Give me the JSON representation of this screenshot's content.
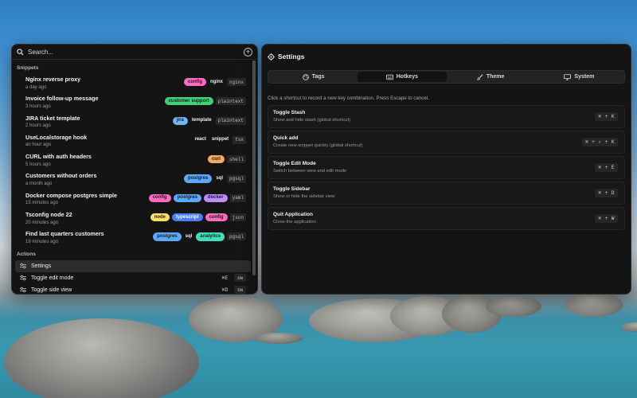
{
  "search": {
    "placeholder": "Search..."
  },
  "snippets": {
    "section_title": "Snippets",
    "items": [
      {
        "name": "Nginx reverse proxy",
        "time": "a day ago",
        "tags": [
          {
            "label": "config",
            "color": "#ff6bc1"
          },
          {
            "label": "nginx",
            "color": null
          }
        ],
        "lang": "nginx"
      },
      {
        "name": "Invoice follow-up message",
        "time": "3 hours ago",
        "tags": [
          {
            "label": "customer support",
            "color": "#3fd17a"
          }
        ],
        "lang": "plaintext"
      },
      {
        "name": "JIRA ticket template",
        "time": "2 hours ago",
        "tags": [
          {
            "label": "jira",
            "color": "#6fb6ff"
          },
          {
            "label": "template",
            "color": null
          }
        ],
        "lang": "plaintext"
      },
      {
        "name": "UseLocalstorage hook",
        "time": "an hour ago",
        "tags": [
          {
            "label": "react",
            "color": null
          },
          {
            "label": "snippet",
            "color": null
          }
        ],
        "lang": "tsx"
      },
      {
        "name": "CURL with auth headers",
        "time": "5 hours ago",
        "tags": [
          {
            "label": "curl",
            "color": "#ffaa66"
          }
        ],
        "lang": "shell"
      },
      {
        "name": "Customers without orders",
        "time": "a month ago",
        "tags": [
          {
            "label": "postgres",
            "color": "#5ba8ff"
          },
          {
            "label": "sql",
            "color": null
          }
        ],
        "lang": "pgsql"
      },
      {
        "name": "Docker compose postgres simple",
        "time": "15 minutes ago",
        "tags": [
          {
            "label": "config",
            "color": "#ff6bc1"
          },
          {
            "label": "postgres",
            "color": "#5ba8ff"
          },
          {
            "label": "docker",
            "color": "#c08cff"
          }
        ],
        "lang": "yaml"
      },
      {
        "name": "Tsconfig node 22",
        "time": "20 minutes ago",
        "tags": [
          {
            "label": "node",
            "color": "#ffe066"
          },
          {
            "label": "typescript",
            "color": "#4a7cff"
          },
          {
            "label": "config",
            "color": "#ff6bc1"
          }
        ],
        "lang": "json"
      },
      {
        "name": "Find last quarters customers",
        "time": "19 minutes ago",
        "tags": [
          {
            "label": "postgres",
            "color": "#5ba8ff"
          },
          {
            "label": "sql",
            "color": null
          },
          {
            "label": "analytics",
            "color": "#3fe0b8"
          }
        ],
        "lang": "pgsql"
      }
    ]
  },
  "actions": {
    "section_title": "Actions",
    "items": [
      {
        "label": "Settings",
        "shortcut": "",
        "state": "",
        "active": true
      },
      {
        "label": "Toggle edit mode",
        "shortcut": "⌘E",
        "state": "ON",
        "active": false
      },
      {
        "label": "Toggle side view",
        "shortcut": "⌘D",
        "state": "ON",
        "active": false
      }
    ]
  },
  "settings": {
    "title": "Settings",
    "tabs": [
      {
        "label": "Tags",
        "icon": "palette-icon",
        "active": false
      },
      {
        "label": "Hotkeys",
        "icon": "keyboard-icon",
        "active": true
      },
      {
        "label": "Theme",
        "icon": "brush-icon",
        "active": false
      },
      {
        "label": "System",
        "icon": "monitor-icon",
        "active": false
      }
    ],
    "instruction": "Click a shortcut to record a new key combination. Press Escape to cancel.",
    "hotkeys": [
      {
        "title": "Toggle Stash",
        "desc": "Show and hide stash (global shortcut)",
        "keys": "⌘ + K"
      },
      {
        "title": "Quick add",
        "desc": "Create new snippet quickly (global shortcut)",
        "keys": "⌘ + ⇧ + K"
      },
      {
        "title": "Toggle Edit Mode",
        "desc": "Switch between view and edit mode",
        "keys": "⌘ + E"
      },
      {
        "title": "Toggle Sidebar",
        "desc": "Show or hide the sidebar view",
        "keys": "⌘ + D"
      },
      {
        "title": "Quit Application",
        "desc": "Close the application",
        "keys": "⌘ + W"
      }
    ]
  }
}
